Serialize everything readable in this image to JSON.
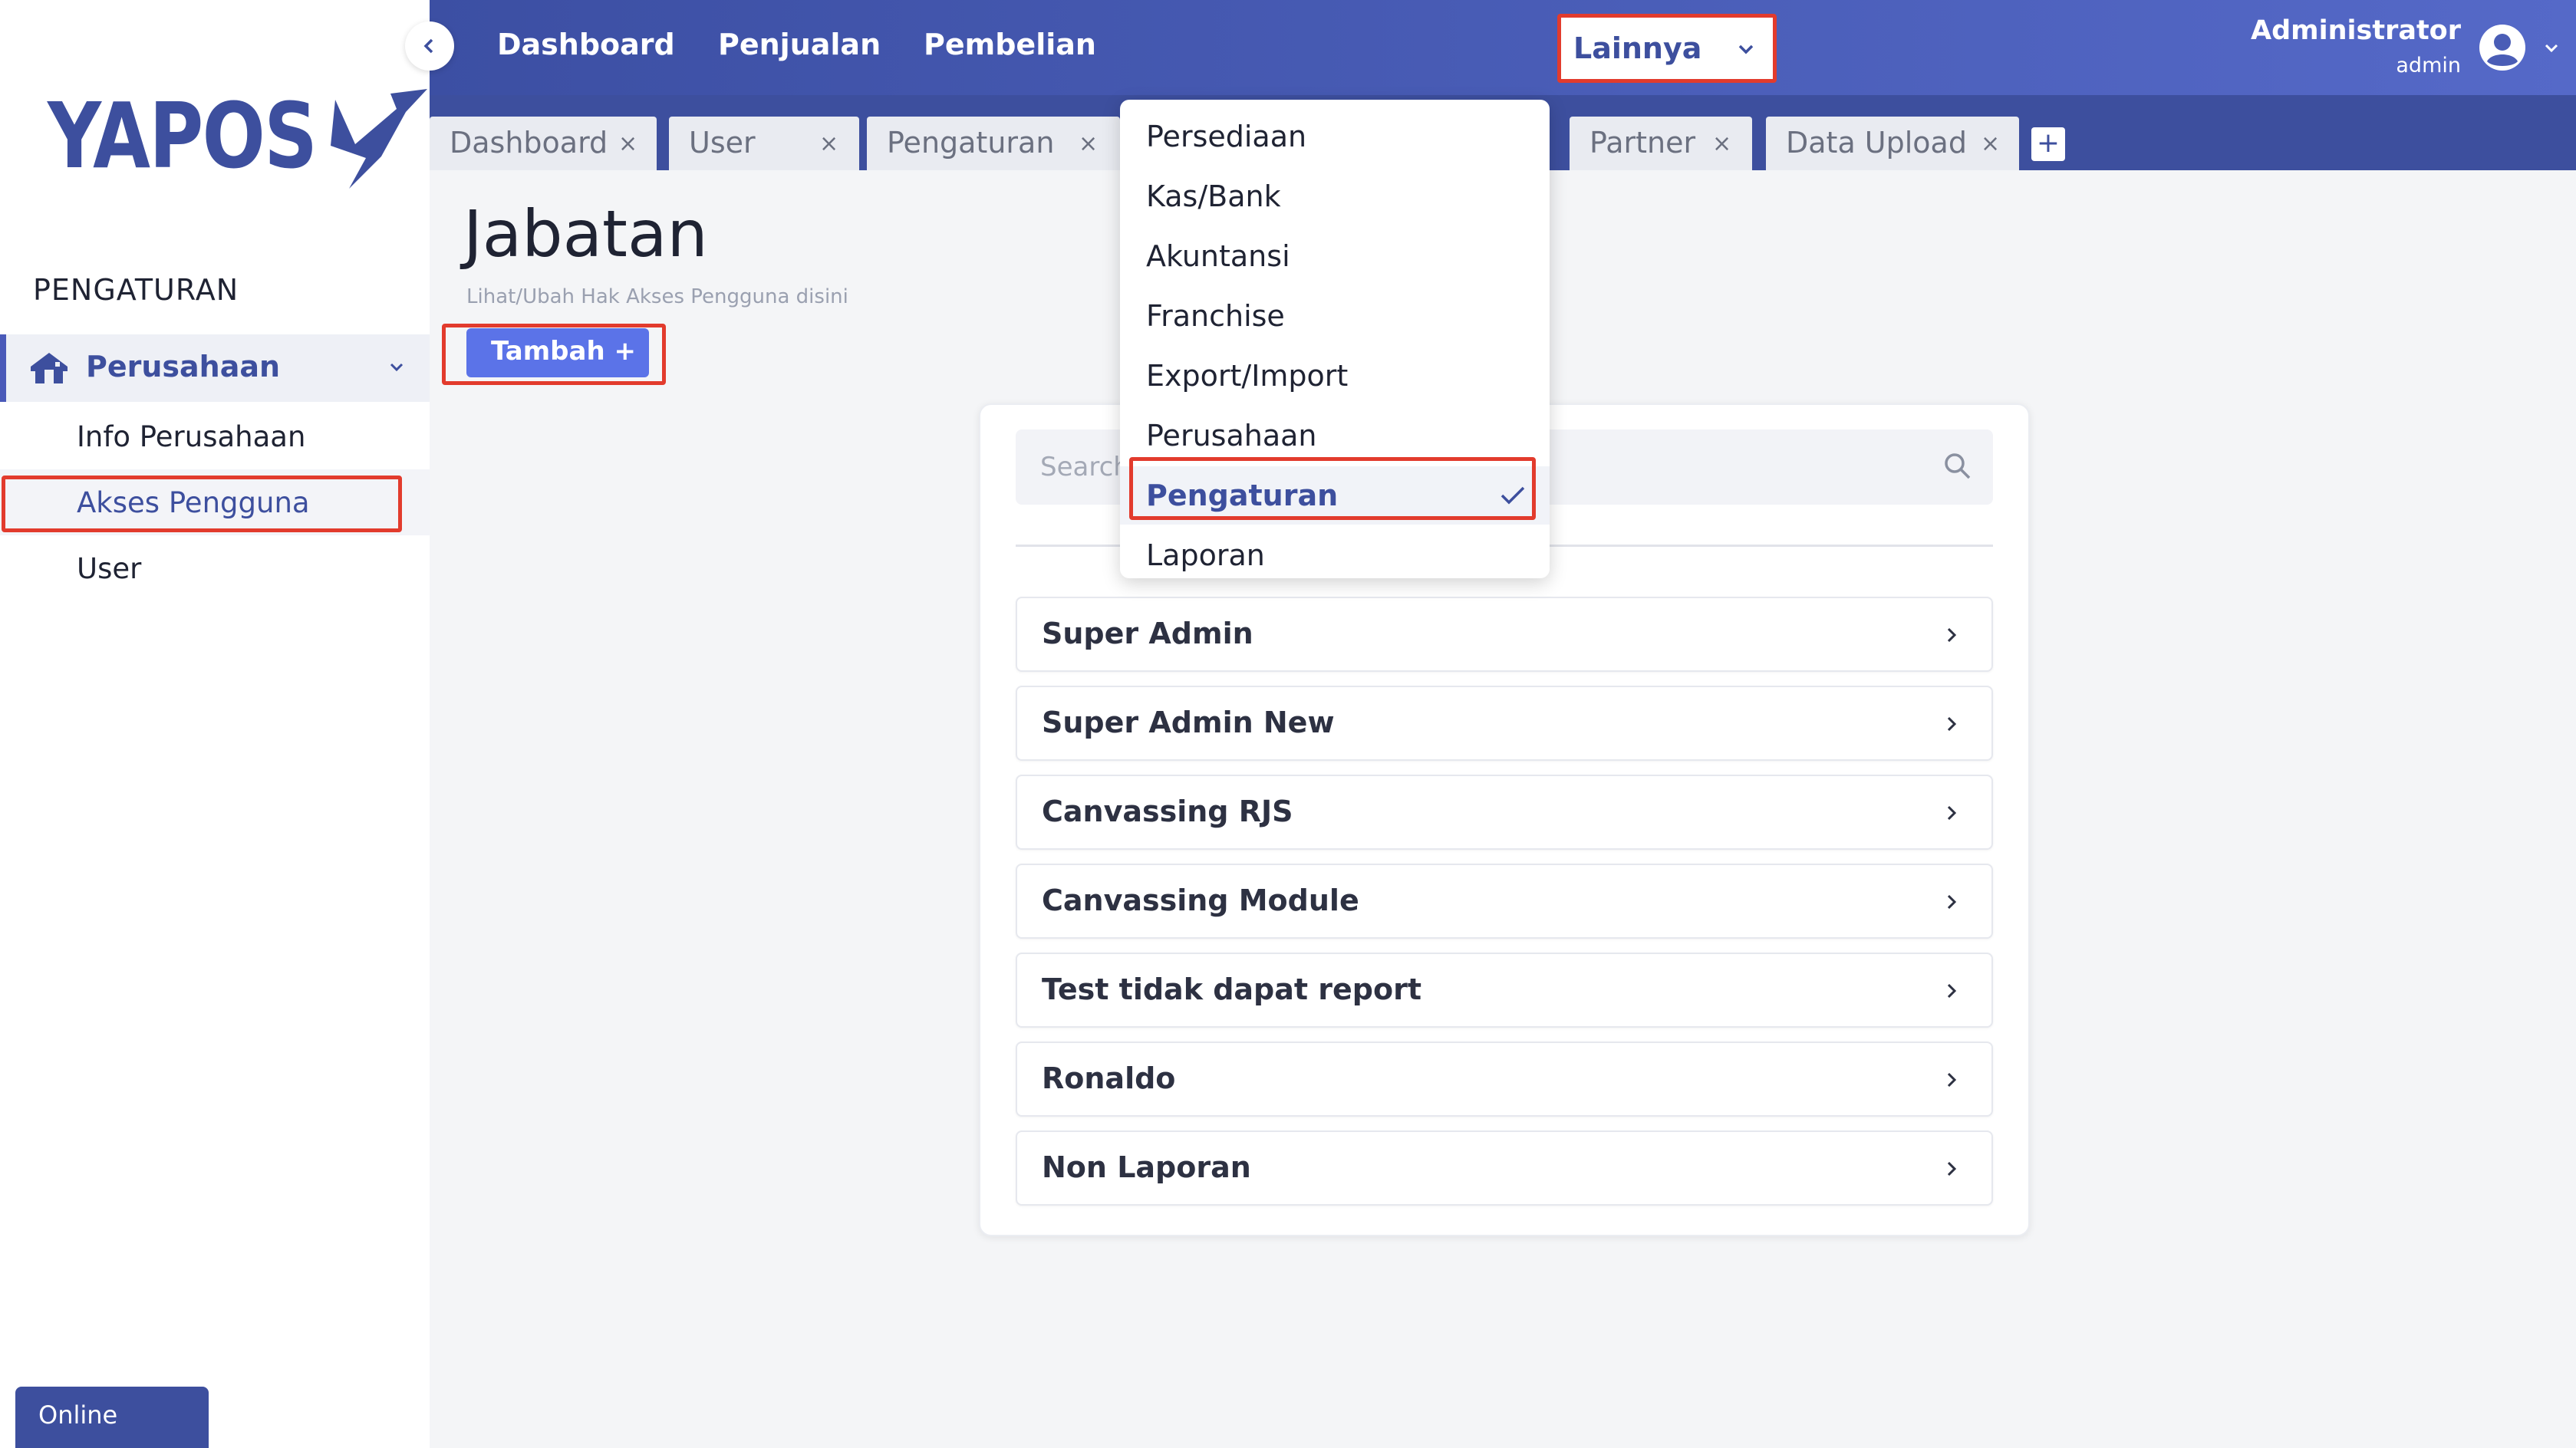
{
  "app": {
    "logo_text": "YAPOS"
  },
  "sidebar": {
    "section_title": "PENGATURAN",
    "parent_item": {
      "label": "Perusahaan",
      "icon": "home-icon"
    },
    "sub_items": [
      {
        "label": "Info Perusahaan",
        "active": false
      },
      {
        "label": "Akses Pengguna",
        "active": true
      },
      {
        "label": "User",
        "active": false
      }
    ],
    "status_badge": "Online"
  },
  "topnav": {
    "items": [
      "Dashboard",
      "Penjualan",
      "Pembelian"
    ],
    "dropdown_label": "Lainnya",
    "user": {
      "name": "Administrator",
      "role": "admin"
    }
  },
  "tabs": [
    {
      "label": "Dashboard",
      "close": "×"
    },
    {
      "label": "User",
      "close": "×"
    },
    {
      "label": "Pengaturan",
      "close": "×"
    },
    {
      "label": "Partner",
      "close": "×"
    },
    {
      "label": "Data Upload",
      "close": "×"
    }
  ],
  "tab_add_label": "+",
  "page": {
    "title": "Jabatan",
    "subtitle": "Lihat/Ubah Hak Akses Pengguna disini",
    "add_button": "Tambah +",
    "search_placeholder": "Search"
  },
  "roles": [
    "Super Admin",
    "Super Admin New",
    "Canvassing RJS",
    "Canvassing Module",
    "Test tidak dapat report",
    "Ronaldo",
    "Non Laporan"
  ],
  "dropdown_menu": {
    "items": [
      "Persediaan",
      "Kas/Bank",
      "Akuntansi",
      "Franchise",
      "Export/Import",
      "Perusahaan",
      "Pengaturan",
      "Laporan"
    ],
    "selected": "Pengaturan"
  },
  "colors": {
    "brand": "#3d4f9e",
    "accent_button": "#5b73e8",
    "annotation": "#e23b2d"
  }
}
